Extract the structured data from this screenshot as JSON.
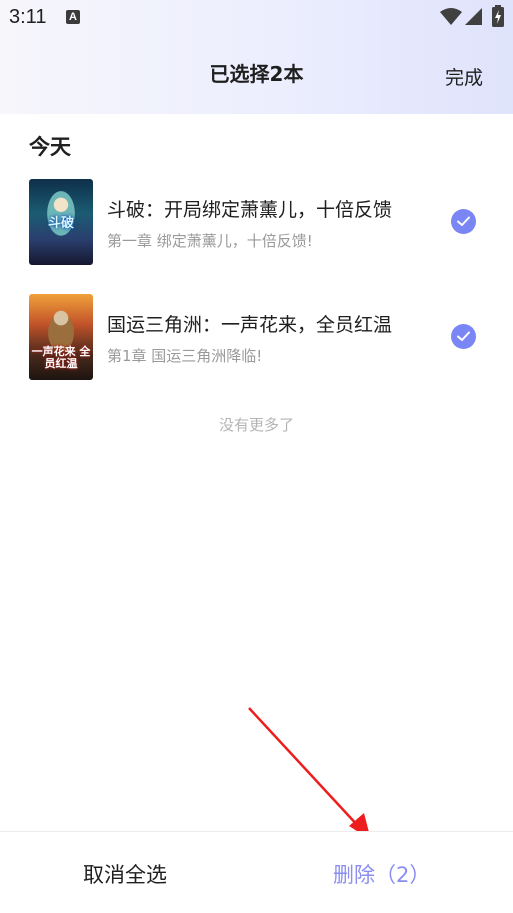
{
  "status_bar": {
    "time": "3:11",
    "notification_icon": "a-icon"
  },
  "header": {
    "title": "已选择2本",
    "done_label": "完成"
  },
  "section": {
    "title": "今天"
  },
  "books": [
    {
      "title": "斗破：开局绑定萧薰儿，十倍反馈",
      "chapter": "第一章 绑定萧薰儿，十倍反馈!",
      "cover_text": "斗破",
      "selected": true
    },
    {
      "title": "国运三角洲：一声花来，全员红温",
      "chapter": "第1章 国运三角洲降临!",
      "cover_text": "一声花来 全员红温",
      "selected": true
    }
  ],
  "no_more_text": "没有更多了",
  "bottom_bar": {
    "cancel_all_label": "取消全选",
    "delete_label": "删除（2）"
  },
  "colors": {
    "accent": "#7b86f5",
    "delete_text": "#8a8ef3",
    "annotation_arrow": "#ee1d1d"
  }
}
